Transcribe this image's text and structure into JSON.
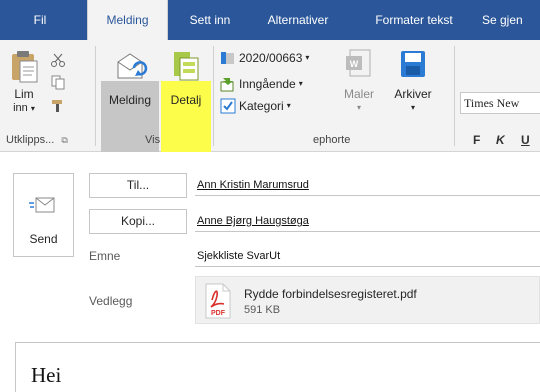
{
  "tabs": [
    {
      "label": "Fil"
    },
    {
      "label": "Melding"
    },
    {
      "label": "Sett inn"
    },
    {
      "label": "Alternativer"
    },
    {
      "label": "Formater tekst"
    },
    {
      "label": "Se gjen"
    }
  ],
  "ribbon": {
    "clipboard": {
      "paste_label_1": "Lim",
      "paste_label_2": "inn",
      "group_label": "Utklipps..."
    },
    "view": {
      "message_label": "Melding",
      "detail_label": "Detalj",
      "group_label": "Vis"
    },
    "ephorte": {
      "case_number": "2020/00663",
      "direction": "Inngående",
      "category": "Kategori",
      "templates_label": "Maler",
      "archive_label": "Arkiver",
      "group_label": "ephorte"
    },
    "font": {
      "font_name": "Times New",
      "bold": "F",
      "italic": "K",
      "underline": "U"
    }
  },
  "compose": {
    "send_label": "Send",
    "to_button": "Til...",
    "to_value": "Ann Kristin Marumsrud",
    "cc_button": "Kopi...",
    "cc_value": "Anne Bjørg Haugstøga",
    "subject_label": "Emne",
    "subject_value": "Sjekkliste SvarUt",
    "attachments_label": "Vedlegg",
    "attachment": {
      "name": "Rydde forbindelsesregisteret.pdf",
      "size": "591 KB",
      "type_badge": "PDF"
    },
    "body_text": "Hei"
  },
  "colors": {
    "titlebar": "#2b579a",
    "ribbon_bg": "#f3f3f3",
    "highlight": "#fcfc4a",
    "pdf_red": "#d9302c"
  }
}
